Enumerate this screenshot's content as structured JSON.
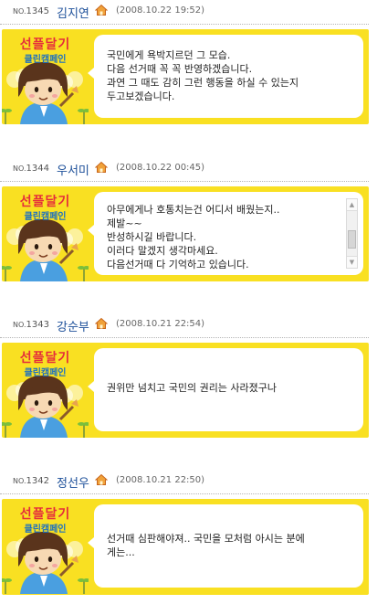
{
  "posts": [
    {
      "no_prefix": "NO.",
      "no": "1345",
      "name": "김지연",
      "date": "(2008.10.22 19:52)",
      "message": "국민에게 욕박지르던 그 모습.\n다음 선거때 꼭 꼭 반영하겠습니다.\n과연 그 때도 감히 그런 행동을 하실 수 있는지\n두고보겠습니다.",
      "has_scrollbar": false
    },
    {
      "no_prefix": "NO.",
      "no": "1344",
      "name": "우서미",
      "date": "(2008.10.22 00:45)",
      "message": "아무에게나 호통치는건 어디서 배웠는지..\n제발~~\n반성하시길 바랍니다.\n이러다 말겠지 생각마세요.\n다음선거때 다 기억하고 있습니다.",
      "has_scrollbar": true
    },
    {
      "no_prefix": "NO.",
      "no": "1343",
      "name": "강순부",
      "date": "(2008.10.21 22:54)",
      "message": "권위만 넘치고 국민의 권리는 사라졌구나",
      "has_scrollbar": false
    },
    {
      "no_prefix": "NO.",
      "no": "1342",
      "name": "정선우",
      "date": "(2008.10.21 22:50)",
      "message": "선거때 심판해야져.. 국민을 모처럼 아시는 분에\n게는...",
      "has_scrollbar": false
    }
  ],
  "banner": {
    "line1": "선플달기",
    "line2": "클린캠페인"
  },
  "icons": {
    "home": "home-icon",
    "scroll_up": "scroll-up-arrow-icon",
    "scroll_down": "scroll-down-arrow-icon"
  },
  "colors": {
    "card_bg": "#f9e022",
    "name": "#1c4f99",
    "banner_red": "#e52d3b",
    "banner_blue": "#1b6fc2"
  }
}
